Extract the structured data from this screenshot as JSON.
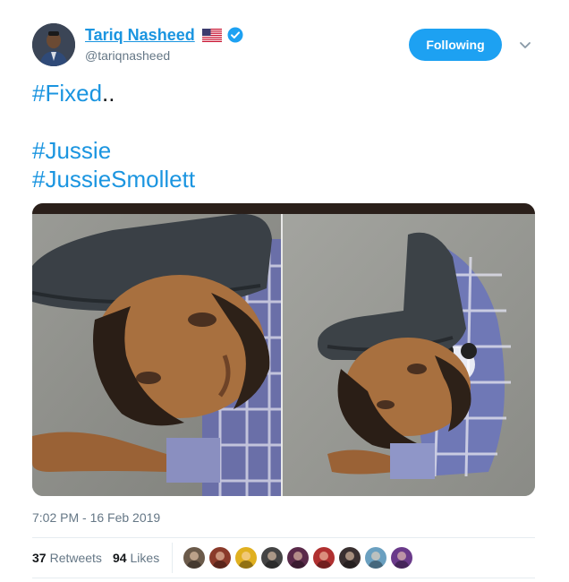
{
  "author": {
    "display_name": "Tariq Nasheed",
    "handle": "@tariqnasheed",
    "avatar_icon": "profile-photo",
    "flag_icon": "us-flag-icon",
    "verified_icon": "verified-badge-icon"
  },
  "actions": {
    "follow_label": "Following",
    "more_icon": "chevron-down-icon"
  },
  "tweet": {
    "hashtag_fixed": "#Fixed",
    "fixed_suffix": "..",
    "hashtag_jussie": "#Jussie",
    "hashtag_smollett": "#JussieSmollett",
    "media_description_icon": "photo-collage",
    "timestamp": "7:02 PM - 16 Feb 2019"
  },
  "stats": {
    "retweets_count": "37",
    "retweets_label": "Retweets",
    "likes_count": "94",
    "likes_label": "Likes"
  },
  "likers": [
    {
      "icon": "liker-avatar",
      "color": "#6b5a4a"
    },
    {
      "icon": "liker-avatar",
      "color": "#8a3a2a"
    },
    {
      "icon": "liker-avatar",
      "color": "#e0b020"
    },
    {
      "icon": "liker-avatar",
      "color": "#444444"
    },
    {
      "icon": "liker-avatar",
      "color": "#5a2a4a"
    },
    {
      "icon": "liker-avatar",
      "color": "#b03030"
    },
    {
      "icon": "liker-avatar",
      "color": "#3a3030"
    },
    {
      "icon": "liker-avatar",
      "color": "#6aa0c0"
    },
    {
      "icon": "liker-avatar",
      "color": "#6a3a8a"
    }
  ],
  "colors": {
    "accent": "#1da1f2",
    "link": "#1b95e0",
    "muted": "#657786"
  }
}
